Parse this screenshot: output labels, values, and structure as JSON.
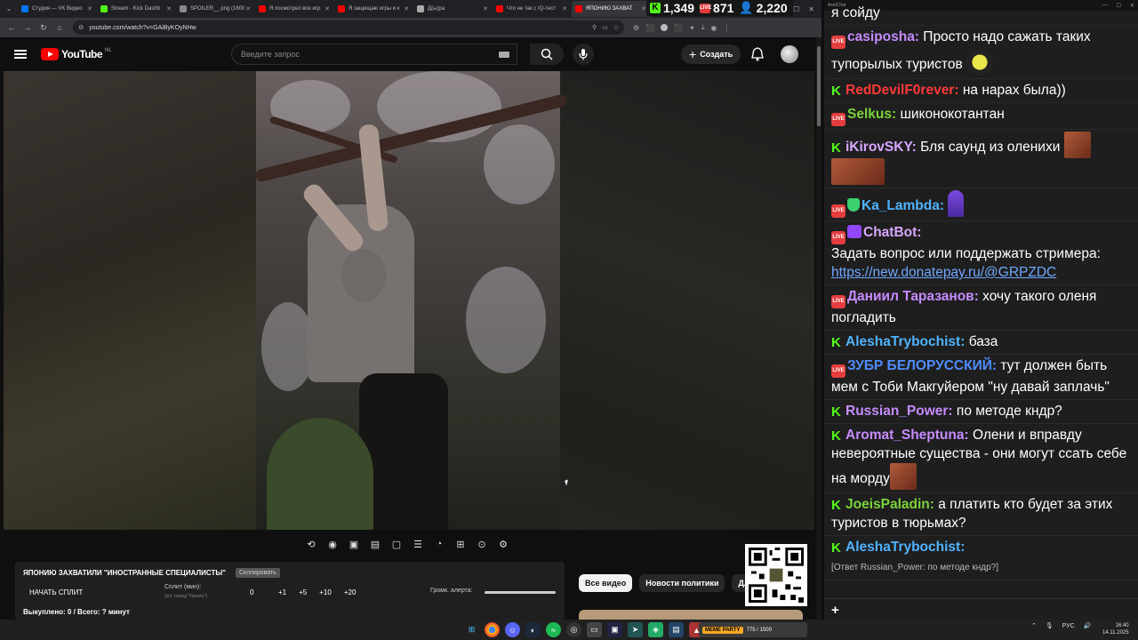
{
  "browser": {
    "tabs": [
      {
        "label": "Студия — VK Видео",
        "color": "#0077ff"
      },
      {
        "label": "Stream - Kick Dashb",
        "color": "#53fc18"
      },
      {
        "label": "SPOILER__.png (1600",
        "color": "#888888"
      },
      {
        "label": "Я посмотрел все игр",
        "color": "#ff0000"
      },
      {
        "label": "Я защищаю игры и к",
        "color": "#ff0000"
      },
      {
        "label": "Д(ы)ра",
        "color": "#aaaaaa"
      },
      {
        "label": "Что не так с IQ-тест",
        "color": "#ff0000"
      },
      {
        "label": "ЯПОНИЮ ЗАХВАТ",
        "color": "#ff0000"
      }
    ],
    "url": "youtube.com/watch?v=GAiByKOyNHw"
  },
  "stats": {
    "kick": "1,349",
    "vk": "871",
    "viewers": "2,220"
  },
  "youtube": {
    "logo": "YouTube",
    "region": "NL",
    "search_placeholder": "Введите запрос",
    "create_label": "Создать"
  },
  "panel": {
    "title": "ЯПОНИЮ ЗАХВАТИЛИ \"ИНОСТРАННЫЕ СПЕЦИАЛИСТЫ\"",
    "badge": "Скопировать",
    "start": "НАЧАТЬ СПЛИТ",
    "split_label": "Сплит (мин):",
    "split_hint": "(уст. перед \"Начать\")",
    "split_value": "0",
    "increments": [
      "+1",
      "+5",
      "+10",
      "+20"
    ],
    "volume_label": "Громк. алерта:",
    "progress_text": "Выкуплено: 0 / Всего: ? минут"
  },
  "chips": [
    "Все видео",
    "Новости политики",
    "Для в"
  ],
  "chat": {
    "window_title": "AxelChat",
    "top_partial": "я сойду",
    "messages": [
      {
        "src": "vk",
        "nick": "casiposha:",
        "color": "#c58cff",
        "text": "Просто надо сажать таких тупорылых туристов"
      },
      {
        "src": "kick",
        "nick": "RedDevilF0rever:",
        "color": "#ff3a3a",
        "text": "на нарах была))"
      },
      {
        "src": "vk",
        "nick": "Selkus:",
        "color": "#7bd33b",
        "text": "шиконокотантан"
      },
      {
        "src": "kick",
        "nick": "iKirovSKY:",
        "color": "#d7a7ff",
        "text": "Бля саунд из оленихи"
      },
      {
        "src": "vk",
        "nick": "Ka_Lambda:",
        "color": "#4fb3ff",
        "text": ""
      },
      {
        "src": "vk",
        "nick": "ChatBot:",
        "color": "#d7a7ff",
        "text": "Задать вопрос или поддержать стримера:",
        "link": "https://new.donatepay.ru/@GRPZDC"
      },
      {
        "src": "vk",
        "nick": "Даниил Таразанов:",
        "color": "#c58cff",
        "text": "хочу такого оленя погладить"
      },
      {
        "src": "kick",
        "nick": "AleshaTrybochist:",
        "color": "#4fb3ff",
        "text": "база"
      },
      {
        "src": "vk",
        "nick": "ЗУБР БЕЛОРУССКИЙ:",
        "color": "#4f8cff",
        "text": "тут должен быть мем с Тоби Макгуйером \"ну давай заплачь\""
      },
      {
        "src": "kick",
        "nick": "Russian_Power:",
        "color": "#c58cff",
        "text": "по методе кндр?"
      },
      {
        "src": "kick",
        "nick": "Aromat_Sheptuna:",
        "color": "#c58cff",
        "text": "Олени и вправду невероятные существа - они могут ссать себе на морду"
      },
      {
        "src": "kick",
        "nick": "JoeisPaladin:",
        "color": "#7bd33b",
        "text": "а платить кто будет за этих туристов в тюрьмах?"
      },
      {
        "src": "kick",
        "nick": "AleshaTrybochist:",
        "color": "#4fb3ff",
        "text": "",
        "reply": "[Ответ Russian_Power: по методе кндр?]"
      }
    ],
    "input_plus": "+"
  },
  "taskbar": {
    "meme_tag": "MEME PARTY",
    "meme_progress": "775 / 1500",
    "lang": "РУС",
    "time": "16:40",
    "date": "14.11.2025"
  }
}
